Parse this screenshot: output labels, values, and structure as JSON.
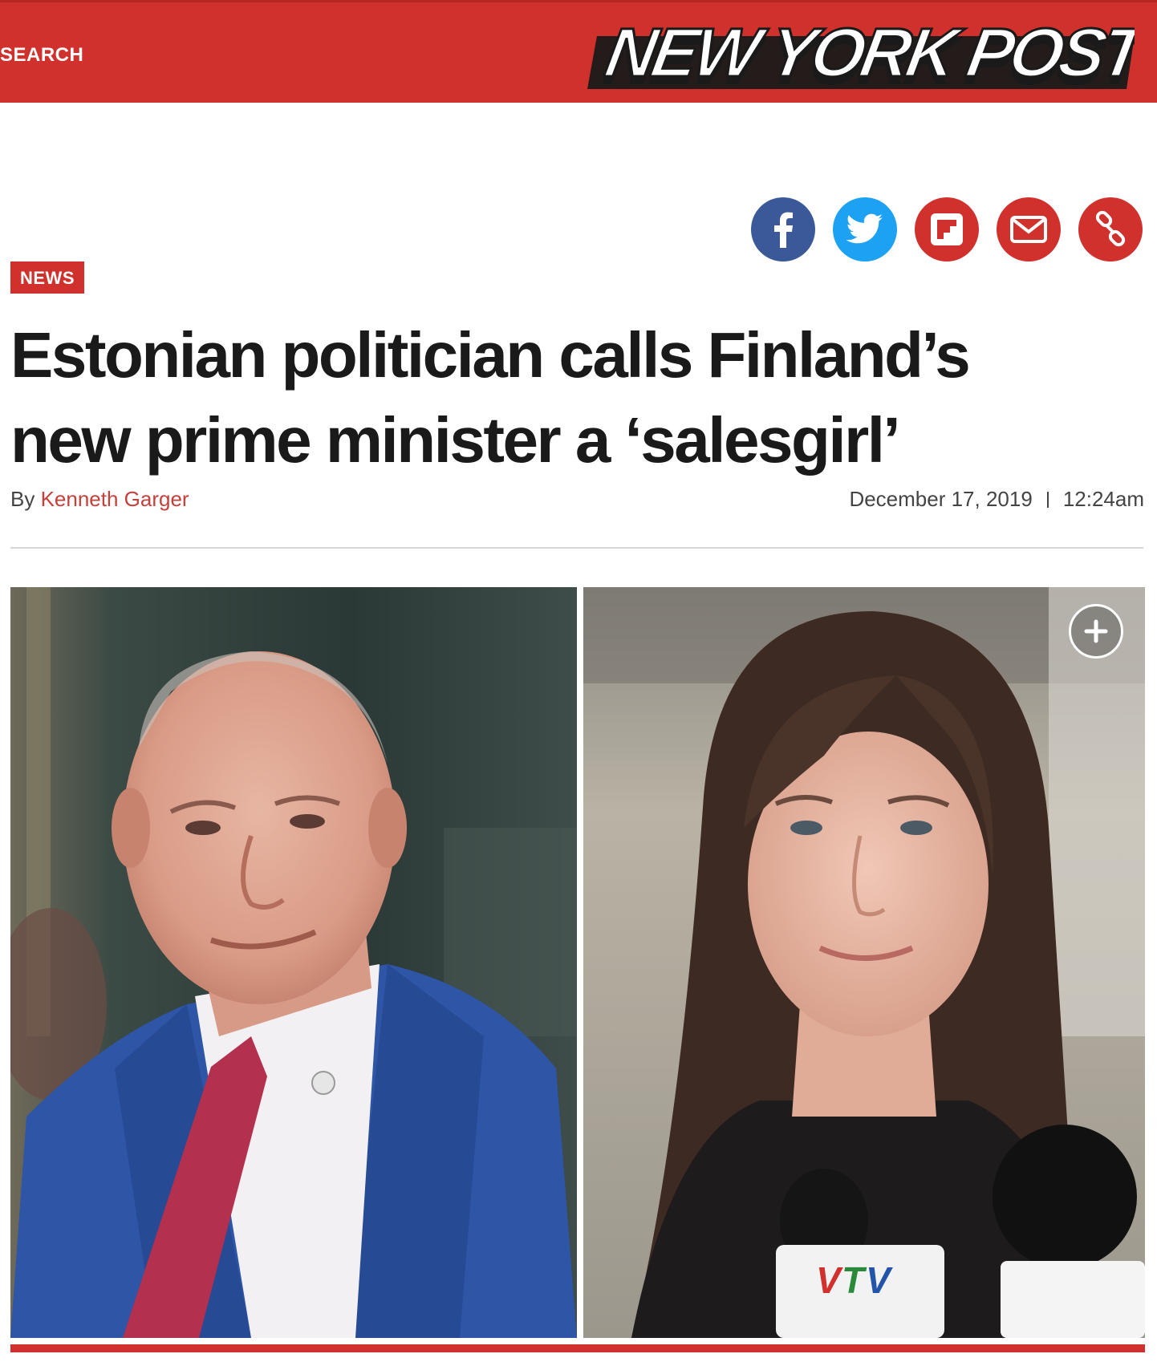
{
  "header": {
    "search_label": "SEARCH",
    "logo_text": "NEW YORK POST",
    "brand_color": "#d0312d"
  },
  "share": {
    "icons": [
      "facebook-icon",
      "twitter-icon",
      "flipboard-icon",
      "email-icon",
      "link-icon"
    ]
  },
  "article": {
    "section": "NEWS",
    "headline_line1": "Estonian politician calls Finland’s",
    "headline_line2": "new prime minister a ‘salesgirl’",
    "by_prefix": "By",
    "author": "Kenneth Garger",
    "date": "December 17, 2019",
    "time": "12:24am"
  },
  "media": {
    "expand_icon": "plus-icon"
  }
}
